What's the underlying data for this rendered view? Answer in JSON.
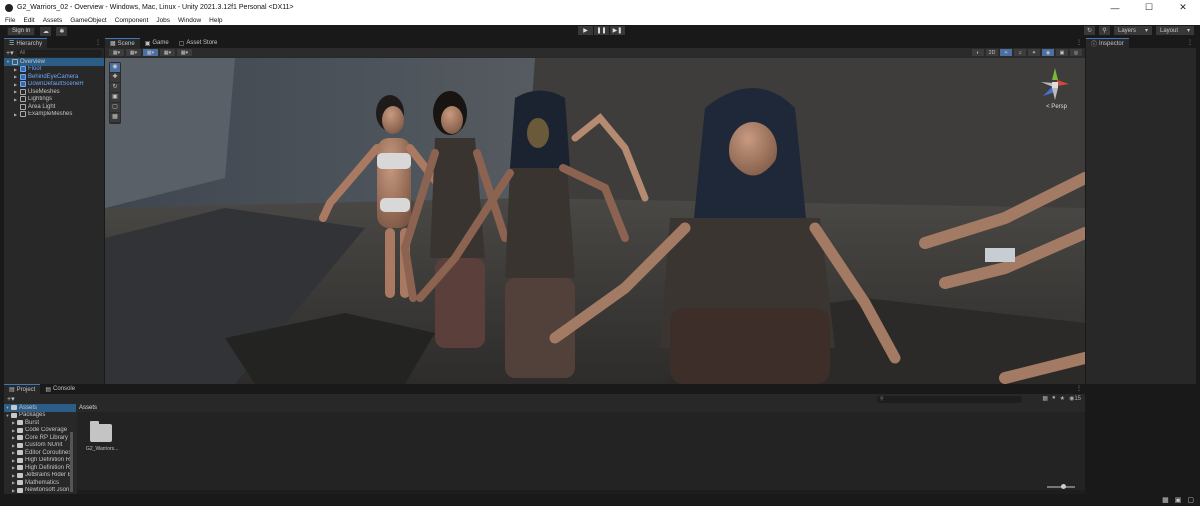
{
  "window": {
    "title": "G2_Warriors_02 - Overview - Windows, Mac, Linux - Unity 2021.3.12f1 Personal <DX11>"
  },
  "menu": [
    "File",
    "Edit",
    "Assets",
    "GameObject",
    "Component",
    "Jobs",
    "Window",
    "Help"
  ],
  "toolbar": {
    "signin": "Sign in",
    "layers": "Layers",
    "layout": "Layout"
  },
  "hierarchy": {
    "tab": "Hierarchy",
    "search_placeholder": "All",
    "items": [
      {
        "label": "Overview"
      },
      {
        "label": "Floor"
      },
      {
        "label": "BehindEyeCamera"
      },
      {
        "label": "DownDefaultSceneR"
      },
      {
        "label": "UseMeshes"
      },
      {
        "label": "Lightings"
      },
      {
        "label": "Area Light"
      },
      {
        "label": "ExampleMeshes"
      }
    ]
  },
  "scene": {
    "tabs": [
      "Scene",
      "Game",
      "Asset Store"
    ],
    "mode_2d": "2D",
    "persp_label": "< Persp"
  },
  "inspector": {
    "tab": "Inspector"
  },
  "bottom": {
    "tabs": [
      "Project",
      "Console"
    ],
    "count": "15",
    "assets_crumb": "Assets",
    "tree": [
      {
        "label": "Assets"
      },
      {
        "label": "Packages"
      },
      {
        "label": "Burst"
      },
      {
        "label": "Code Coverage"
      },
      {
        "label": "Core RP Library"
      },
      {
        "label": "Custom NUnit"
      },
      {
        "label": "Editor Coroutines"
      },
      {
        "label": "High Definition R"
      },
      {
        "label": "High Definition R"
      },
      {
        "label": "JetBrains Rider E"
      },
      {
        "label": "Mathematics"
      },
      {
        "label": "Newtonsoft Json"
      }
    ],
    "asset_tiles": [
      {
        "label": "G2_Warriors..."
      }
    ]
  },
  "colors": {
    "accent": "#3a79bb",
    "selection": "#2c5d87",
    "prefab_blue": "#6aa7f8"
  }
}
